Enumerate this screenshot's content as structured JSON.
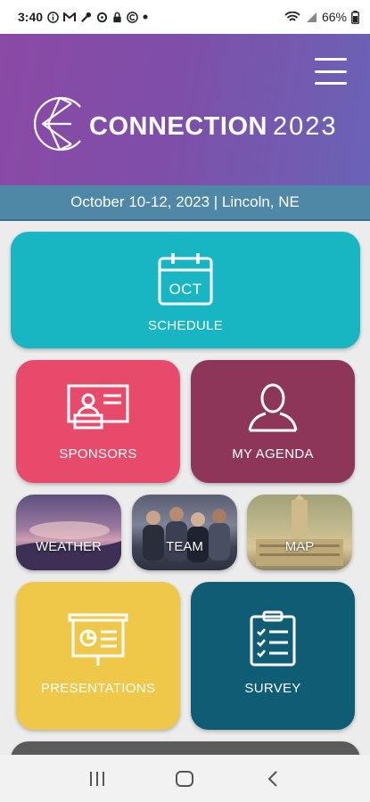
{
  "status_bar": {
    "time": "3:40",
    "battery": "66%",
    "left_icons": [
      "info-icon",
      "gmail-icon",
      "wrench-icon",
      "sync-icon",
      "lock-icon",
      "app-icon",
      "dot-icon"
    ],
    "right_icons": [
      "wifi-icon",
      "signal-icon",
      "battery-icon"
    ]
  },
  "header": {
    "title": "CONNECTION",
    "year": "2023",
    "gradient": [
      "#8a4aa6",
      "#6a63b6"
    ]
  },
  "event_info": "October 10-12, 2023 | Lincoln, NE",
  "tiles": {
    "schedule": {
      "label": "SCHEDULE",
      "icon_text": "OCT",
      "color": "#18b5c2"
    },
    "sponsors": {
      "label": "SPONSORS",
      "color": "#e84a6b"
    },
    "agenda": {
      "label": "MY AGENDA",
      "color": "#8e3659"
    },
    "weather": {
      "label": "WEATHER"
    },
    "team": {
      "label": "TEAM"
    },
    "map": {
      "label": "MAP"
    },
    "presentations": {
      "label": "PRESENTATIONS",
      "color": "#efc84a"
    },
    "survey": {
      "label": "SURVEY",
      "color": "#0f5d75"
    }
  },
  "nav": {
    "icons": [
      "recents-icon",
      "home-icon",
      "back-icon"
    ]
  }
}
